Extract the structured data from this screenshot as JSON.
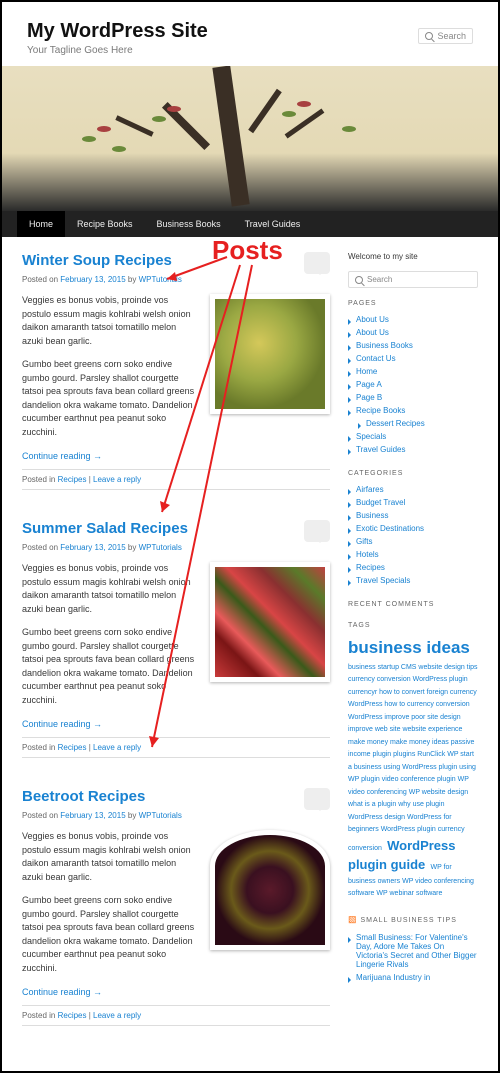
{
  "site": {
    "title": "My WordPress Site",
    "tagline": "Your Tagline Goes Here"
  },
  "search_placeholder": "Search",
  "nav": [
    "Home",
    "Recipe Books",
    "Business Books",
    "Travel Guides"
  ],
  "annotation_label": "Posts",
  "posts": [
    {
      "title": "Winter Soup Recipes",
      "date": "February 13, 2015",
      "author": "WPTutorials",
      "p1": "Veggies es bonus vobis, proinde vos postulo essum magis kohlrabi welsh onion daikon amaranth tatsoi tomatillo melon azuki bean garlic.",
      "p2": "Gumbo beet greens corn soko endive gumbo gourd. Parsley shallot courgette tatsoi pea sprouts fava bean collard greens dandelion okra wakame tomato. Dandelion cucumber earthnut pea peanut soko zucchini.",
      "cont": "Continue reading →",
      "cat": "Recipes",
      "reply": "Leave a reply"
    },
    {
      "title": "Summer Salad Recipes",
      "date": "February 13, 2015",
      "author": "WPTutorials",
      "p1": "Veggies es bonus vobis, proinde vos postulo essum magis kohlrabi welsh onion daikon amaranth tatsoi tomatillo melon azuki bean garlic.",
      "p2": "Gumbo beet greens corn soko endive gumbo gourd. Parsley shallot courgette tatsoi pea sprouts fava bean collard greens dandelion okra wakame tomato. Dandelion cucumber earthnut pea peanut soko zucchini.",
      "cont": "Continue reading →",
      "cat": "Recipes",
      "reply": "Leave a reply"
    },
    {
      "title": "Beetroot Recipes",
      "date": "February 13, 2015",
      "author": "WPTutorials",
      "p1": "Veggies es bonus vobis, proinde vos postulo essum magis kohlrabi welsh onion daikon amaranth tatsoi tomatillo melon azuki bean garlic.",
      "p2": "Gumbo beet greens corn soko endive gumbo gourd. Parsley shallot courgette tatsoi pea sprouts fava bean collard greens dandelion okra wakame tomato. Dandelion cucumber earthnut pea peanut soko zucchini.",
      "cont": "Continue reading →",
      "cat": "Recipes",
      "reply": "Leave a reply"
    }
  ],
  "sidebar": {
    "welcome": "Welcome to my site",
    "pages_title": "PAGES",
    "pages": [
      "About Us",
      "About Us",
      "Business Books",
      "Contact Us",
      "Home",
      "Page A",
      "Page B",
      "Recipe Books",
      "Dessert Recipes",
      "Specials",
      "Travel Guides"
    ],
    "cats_title": "CATEGORIES",
    "cats": [
      "Airfares",
      "Budget Travel",
      "Business",
      "Exotic Destinations",
      "Gifts",
      "Hotels",
      "Recipes",
      "Travel Specials"
    ],
    "recent_title": "RECENT COMMENTS",
    "tags_title": "TAGS",
    "tags_big1": "business ideas",
    "tags_sm1": "business startup CMS website design tips currency conversion WordPress plugin currencyr how to convert foreign currency WordPress how to currency conversion WordPress improve poor site design improve web site website experience make money make money ideas passive income plugin plugins RunClick WP start a business using WordPress plugin using WP plugin video conference plugin WP video conferencing WP website design what is a plugin why use plugin WordPress design WordPress for beginners WordPress plugin currency conversion",
    "tags_big2": "WordPress plugin guide",
    "tags_sm2": "WP for business owners WP video conferencing software WP webinar software",
    "rss_title": "SMALL BUSINESS TIPS",
    "rss_items": [
      "Small Business: For Valentine's Day, Adore Me Takes On Victoria's Secret and Other Bigger Lingerie Rivals",
      "Marijuana Industry in"
    ]
  },
  "meta_labels": {
    "posted_on": "Posted on",
    "by": "by",
    "posted_in": "Posted in"
  }
}
